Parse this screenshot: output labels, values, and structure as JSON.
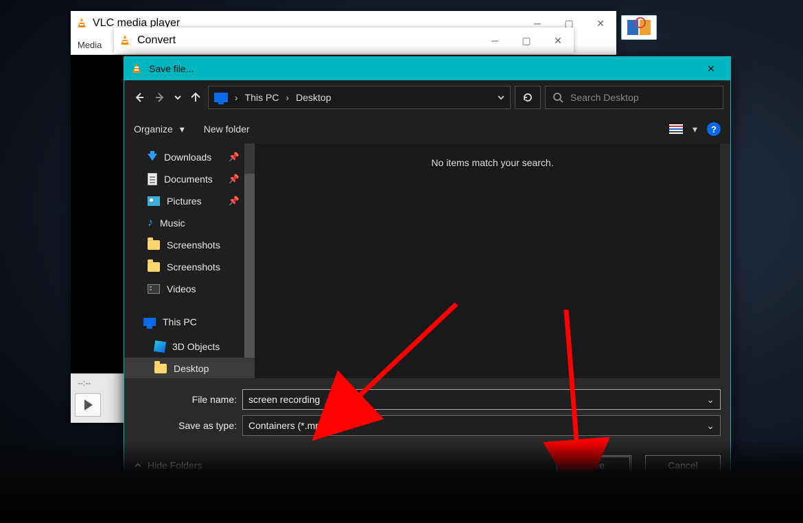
{
  "vlc_main": {
    "title": "VLC media player",
    "menu_media": "Media",
    "time_placeholder": "--:--"
  },
  "convert": {
    "title": "Convert"
  },
  "save_dialog": {
    "title": "Save file...",
    "breadcrumb": {
      "root": "This PC",
      "current": "Desktop"
    },
    "search_placeholder": "Search Desktop",
    "toolbar": {
      "organize": "Organize",
      "new_folder": "New folder"
    },
    "tree": [
      {
        "icon": "download",
        "label": "Downloads",
        "pinned": true
      },
      {
        "icon": "document",
        "label": "Documents",
        "pinned": true
      },
      {
        "icon": "pictures",
        "label": "Pictures",
        "pinned": true
      },
      {
        "icon": "music",
        "label": "Music",
        "pinned": false
      },
      {
        "icon": "folder",
        "label": "Screenshots",
        "pinned": false
      },
      {
        "icon": "folder",
        "label": "Screenshots",
        "pinned": false
      },
      {
        "icon": "video",
        "label": "Videos",
        "pinned": false
      }
    ],
    "tree_section": {
      "icon": "pc",
      "label": "This PC"
    },
    "tree_section_children": [
      {
        "icon": "3d",
        "label": "3D Objects"
      },
      {
        "icon": "folder",
        "label": "Desktop",
        "selected": true
      }
    ],
    "empty_message": "No items match your search.",
    "file_name_label": "File name:",
    "file_name_value": "screen recording ",
    "save_as_type_label": "Save as type:",
    "save_as_type_value": "Containers (*.mp4)",
    "hide_folders": "Hide Folders",
    "save_btn": "Save",
    "cancel_btn": "Cancel"
  }
}
